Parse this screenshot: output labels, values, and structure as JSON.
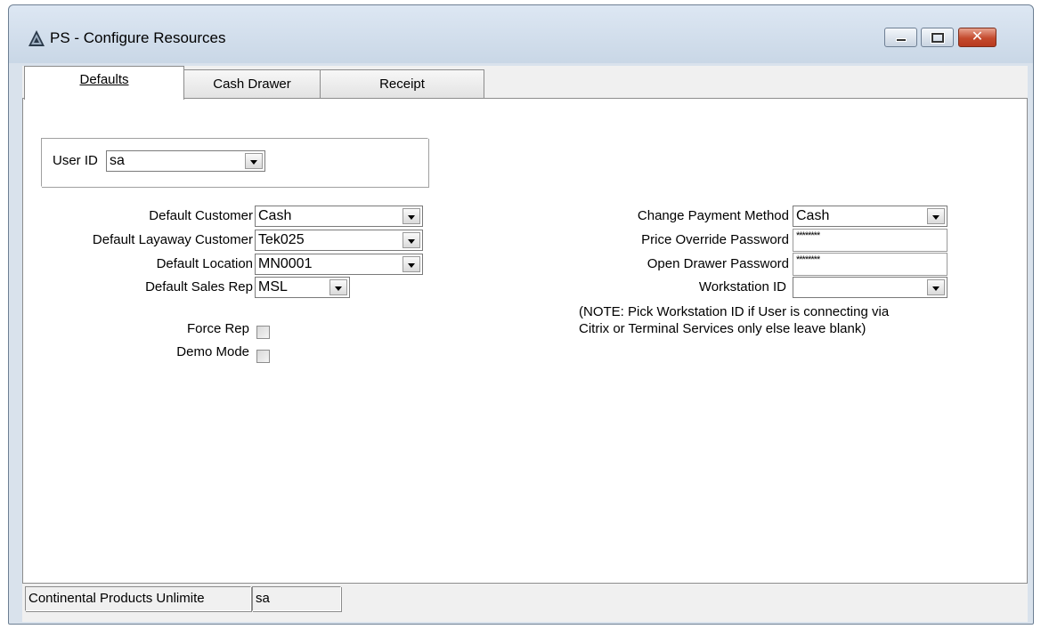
{
  "window": {
    "title": "PS - Configure Resources",
    "close_glyph": "✕"
  },
  "tabs": [
    {
      "label": "Defaults",
      "active": true
    },
    {
      "label": "Cash Drawer",
      "active": false
    },
    {
      "label": "Receipt",
      "active": false
    }
  ],
  "user": {
    "label": "User ID",
    "value": "sa"
  },
  "left_fields": {
    "default_customer": {
      "label": "Default Customer",
      "value": "Cash"
    },
    "default_layaway_customer": {
      "label": "Default Layaway Customer",
      "value": "Tek025"
    },
    "default_location": {
      "label": "Default Location",
      "value": "MN0001"
    },
    "default_sales_rep": {
      "label": "Default Sales Rep",
      "value": "MSL"
    }
  },
  "checkboxes": {
    "force_rep": {
      "label": "Force Rep",
      "checked": false
    },
    "demo_mode": {
      "label": "Demo Mode",
      "checked": false
    }
  },
  "right_fields": {
    "change_payment_method": {
      "label": "Change Payment Method",
      "value": "Cash"
    },
    "price_override_password": {
      "label": "Price Override Password",
      "value": "********"
    },
    "open_drawer_password": {
      "label": "Open Drawer Password",
      "value": "********"
    },
    "workstation_id": {
      "label": "Workstation ID",
      "value": ""
    }
  },
  "note": "(NOTE: Pick Workstation ID if User is connecting via Citrix or Terminal Services only else leave blank)",
  "status": {
    "company": "Continental Products Unlimite",
    "user": "sa"
  },
  "icons": [
    "app-icon",
    "minimize-icon",
    "maximize-icon",
    "close-icon",
    "dropdown-arrow-icon"
  ],
  "colors": {
    "close_button": "#c44a2d",
    "titlebar": "#d2deeb",
    "panel": "#ffffff"
  }
}
